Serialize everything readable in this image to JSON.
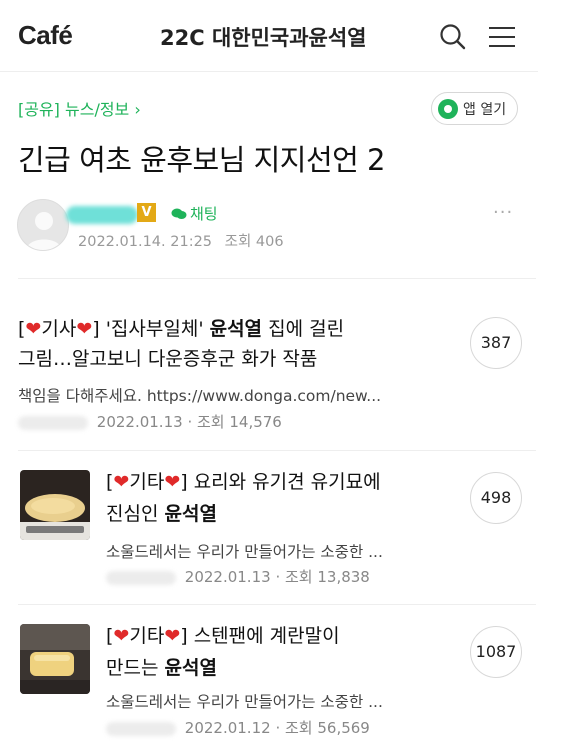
{
  "header": {
    "logo": "Café",
    "cafe_name": "22C 대한민국과윤석열",
    "search_icon": "search-icon",
    "menu_icon": "hamburger-menu-icon"
  },
  "board": {
    "label": "[공유] 뉴스/정보 ›",
    "app_button": "앱 열기"
  },
  "post": {
    "title": "긴급 여초 윤후보님 지지선언 2",
    "author_badge": "V",
    "chat_label": "채팅",
    "date": "2022.01.14. 21:25",
    "views": "조회 406",
    "more": "···"
  },
  "articles": [
    {
      "tag_open": "[",
      "tag_heart": "❤",
      "tag_word": "기사",
      "tag_close": "]",
      "title_pre": " '집사부일체' ",
      "title_bold": "윤석열",
      "title_post": " 집에 걸린",
      "line2_pre": "그림…알고보니 다운증후군 화가 작품",
      "line2_bold": "",
      "snippet": "책임을 다해주세요. https://www.donga.com/new...",
      "date": "2022.01.13",
      "views": "조회 14,576",
      "comments": "387"
    },
    {
      "tag_open": "[",
      "tag_heart": "❤",
      "tag_word": "기타",
      "tag_close": "]",
      "title_pre": " 요리와 유기견 유기묘에",
      "title_bold": "",
      "title_post": "",
      "line2_pre": "진심인 ",
      "line2_bold": "윤석열",
      "snippet": "소울드레서는 우리가 만들어가는 소중한 ...",
      "date": "2022.01.13",
      "views": "조회 13,838",
      "comments": "498"
    },
    {
      "tag_open": "[",
      "tag_heart": "❤",
      "tag_word": "기타",
      "tag_close": "]",
      "title_pre": " 스텐팬에 계란말이",
      "title_bold": "",
      "title_post": "",
      "line2_pre": "만드는 ",
      "line2_bold": "윤석열",
      "snippet": "소울드레서는 우리가 만들어가는 소중한 ...",
      "date": "2022.01.12",
      "views": "조회 56,569",
      "comments": "1087"
    }
  ],
  "colors": {
    "accent_green": "#1fb35a",
    "heart_red": "#e02a2a",
    "badge_gold": "#e3a916"
  }
}
